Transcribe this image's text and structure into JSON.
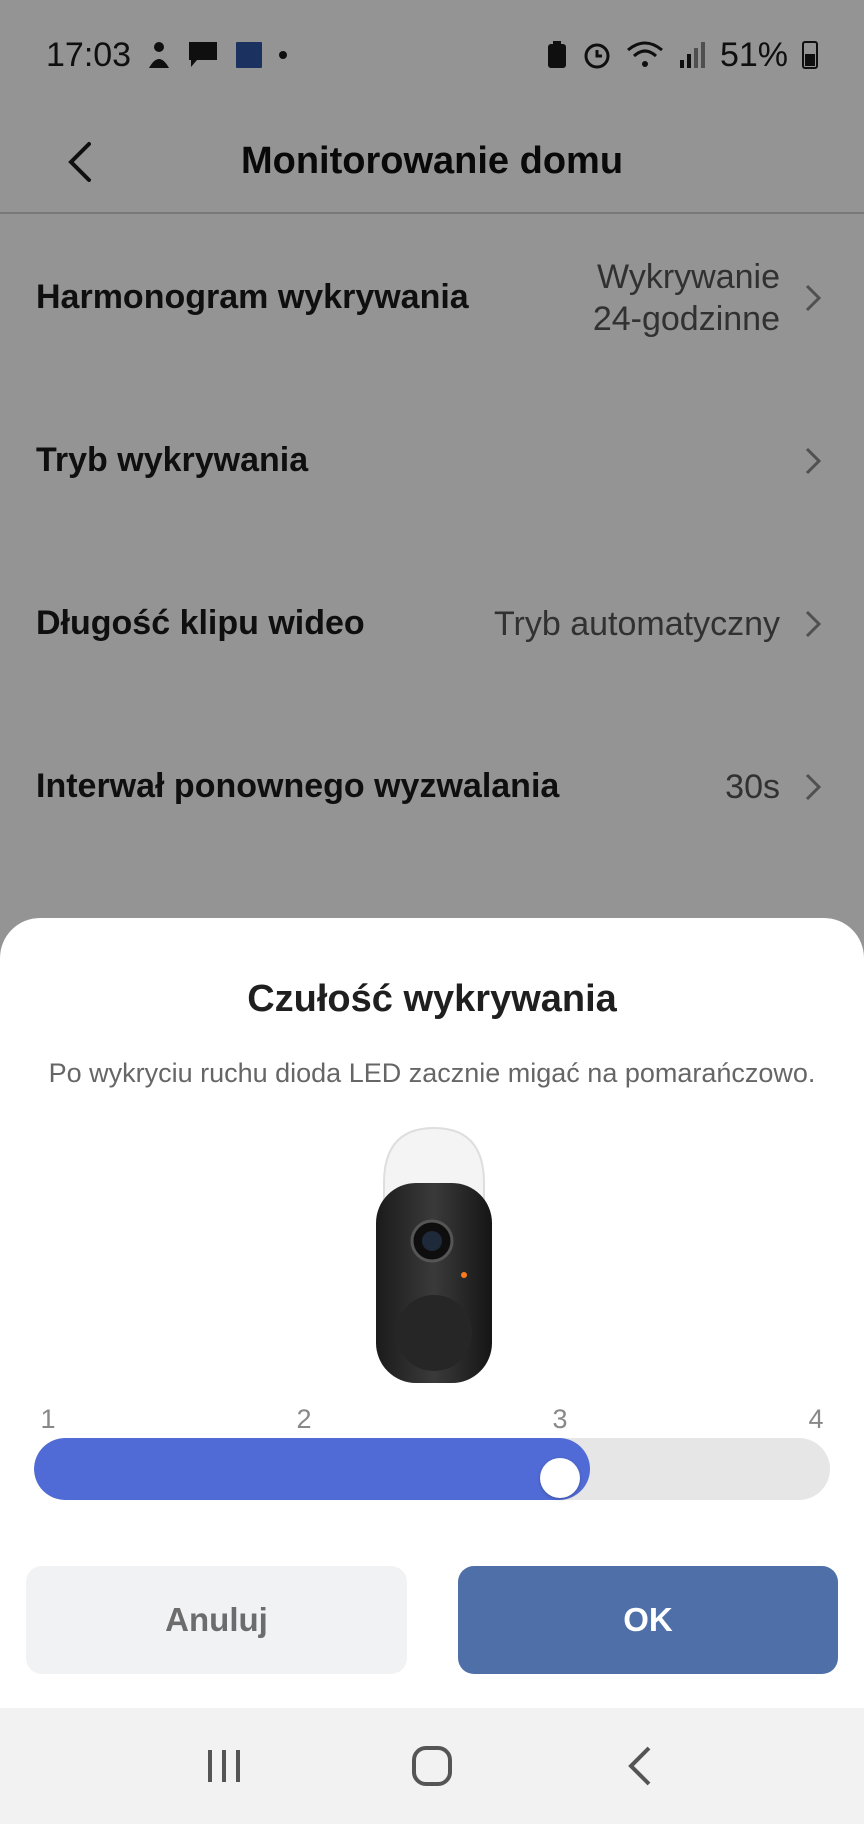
{
  "status_bar": {
    "time": "17:03",
    "battery": "51%",
    "icons": [
      "baby-monitor-icon",
      "chat-icon",
      "app-badge-icon",
      "dot-icon",
      "battery-saver-icon",
      "alarm-icon",
      "wifi-icon",
      "signal-icon",
      "battery-icon"
    ]
  },
  "header": {
    "title": "Monitorowanie domu",
    "back_icon": "chevron-left-icon"
  },
  "settings": [
    {
      "label": "Harmonogram wykrywania",
      "value_line1": "Wykrywanie",
      "value_line2": "24-godzinne"
    },
    {
      "label": "Tryb wykrywania",
      "value_line1": "",
      "value_line2": ""
    },
    {
      "label": "Długość klipu wideo",
      "value_line1": "Tryb automatyczny",
      "value_line2": ""
    },
    {
      "label": "Interwał ponownego wyzwalania",
      "value_line1": "30s",
      "value_line2": ""
    }
  ],
  "sheet": {
    "title": "Czułość wykrywania",
    "description": "Po wykryciu ruchu dioda LED zacznie migać na pomarańczowo.",
    "slider": {
      "ticks": [
        "1",
        "2",
        "3",
        "4"
      ],
      "min": 1,
      "max": 4,
      "value": 3,
      "fill_color": "#516bd6",
      "track_color": "#e6e6e6"
    },
    "cancel_label": "Anuluj",
    "ok_label": "OK",
    "ok_color": "#4f6fa8"
  },
  "nav_bar": {
    "icons": [
      "recent-apps-icon",
      "home-icon",
      "back-icon"
    ]
  }
}
